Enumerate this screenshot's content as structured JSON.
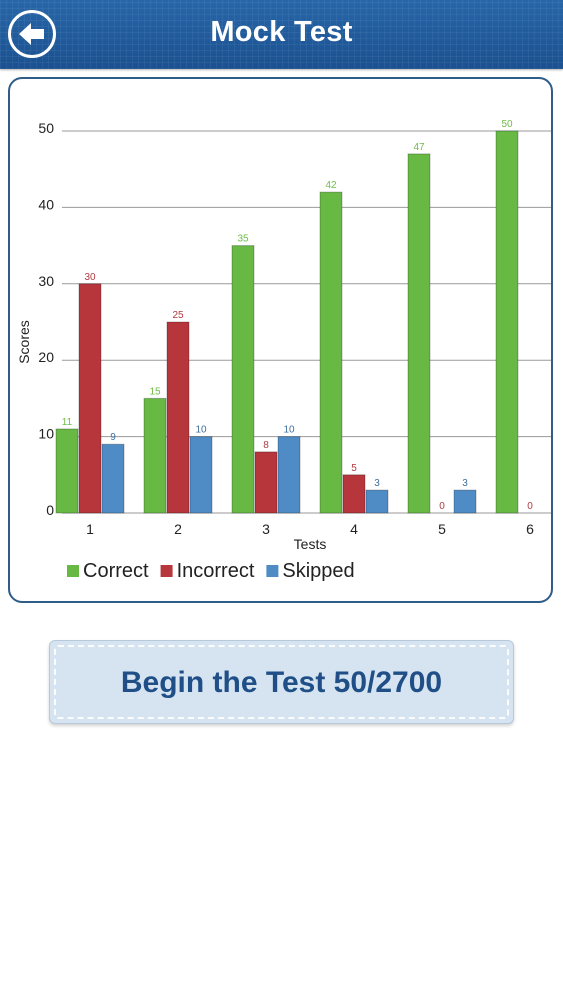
{
  "header": {
    "title": "Mock Test",
    "back_icon": "back-arrow-icon"
  },
  "chart_data": {
    "type": "bar",
    "categories": [
      "1",
      "2",
      "3",
      "4",
      "5",
      "6"
    ],
    "series": [
      {
        "name": "Correct",
        "values": [
          11,
          15,
          35,
          42,
          47,
          50
        ],
        "color": "#67b944",
        "label_color": "#6fbb48"
      },
      {
        "name": "Incorrect",
        "values": [
          30,
          25,
          8,
          5,
          0,
          0
        ],
        "color": "#b7363c",
        "label_color": "#b23a40"
      },
      {
        "name": "Skipped",
        "values": [
          9,
          10,
          10,
          3,
          3,
          null
        ],
        "color": "#4f8cc6",
        "label_color": "#3d6f9e"
      }
    ],
    "title": "",
    "xlabel": "Tests",
    "ylabel": "Scores",
    "ylim": [
      0,
      50
    ],
    "yticks": [
      0,
      10,
      20,
      30,
      40,
      50
    ],
    "grid": true,
    "legend": "bottom-left"
  },
  "actions": {
    "begin_label": "Begin the Test 50/2700"
  }
}
